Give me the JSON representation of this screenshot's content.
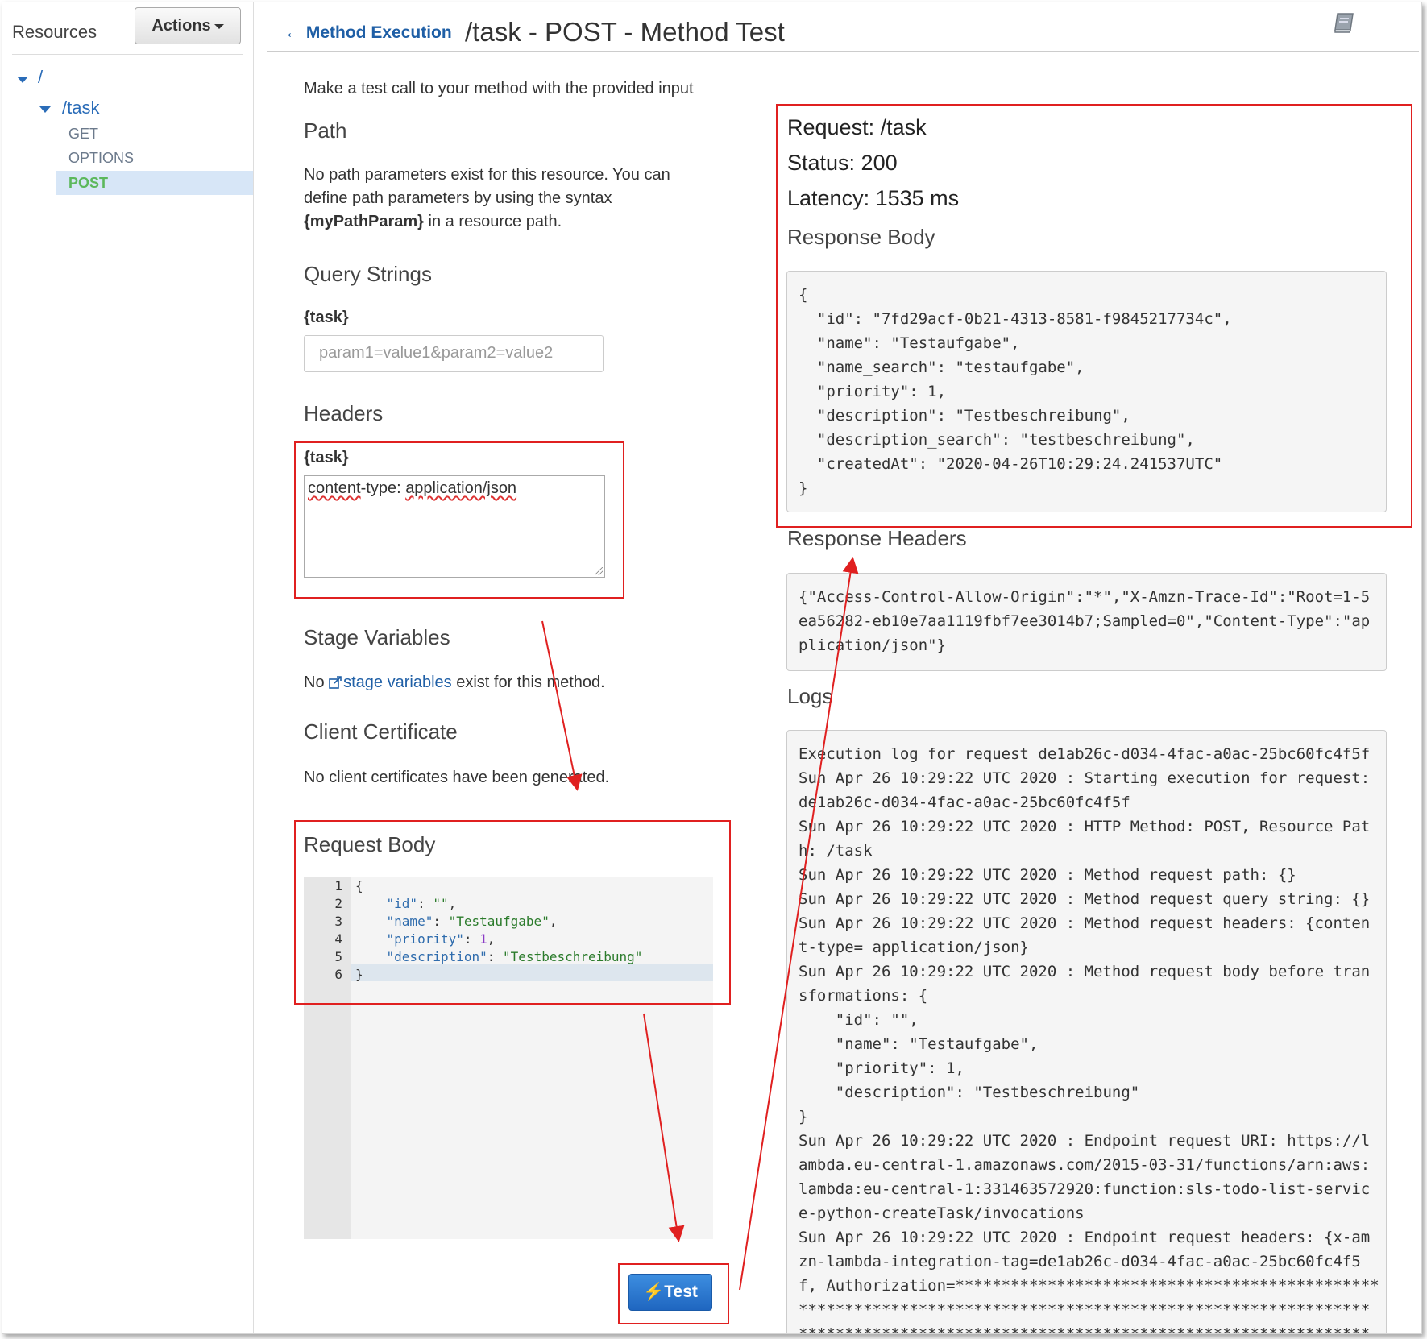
{
  "sidebar": {
    "title": "Resources",
    "actions_label": "Actions",
    "root": "/",
    "resource": "/task",
    "methods": [
      "GET",
      "OPTIONS",
      "POST"
    ]
  },
  "header": {
    "back_label": "Method Execution",
    "title": "/task - POST - Method Test"
  },
  "left": {
    "intro": "Make a test call to your method with the provided input",
    "path_title": "Path",
    "path_text_1": "No path parameters exist for this resource. You can",
    "path_text_2": "define path parameters by using the syntax",
    "path_param": "{myPathParam}",
    "path_text_3": " in a resource path.",
    "query_title": "Query Strings",
    "query_label": "{task}",
    "query_placeholder": "param1=value1&param2=value2",
    "headers_title": "Headers",
    "headers_label": "{task}",
    "headers_value_a": "content",
    "headers_value_b": "-type: ",
    "headers_value_c": "application/json",
    "stage_title": "Stage Variables",
    "stage_pre": "No ",
    "stage_link": "stage variables",
    "stage_post": " exist for this method.",
    "cert_title": "Client Certificate",
    "cert_text": "No client certificates have been generated.",
    "body_title": "Request Body",
    "code_lines": [
      {
        "n": "1",
        "text": "{"
      },
      {
        "n": "2",
        "key": "\"id\"",
        "val": "\"\"",
        "type": "str"
      },
      {
        "n": "3",
        "key": "\"name\"",
        "val": "\"Testaufgabe\"",
        "type": "str"
      },
      {
        "n": "4",
        "key": "\"priority\"",
        "val": "1",
        "type": "num"
      },
      {
        "n": "5",
        "key": "\"description\"",
        "val": "\"Testbeschreibung\"",
        "type": "str",
        "last": true
      },
      {
        "n": "6",
        "text": "}"
      }
    ],
    "test_label": "Test"
  },
  "right": {
    "request": "Request: /task",
    "status": "Status: 200",
    "latency": "Latency: 1535 ms",
    "response_body_title": "Response Body",
    "response_body": "{\n  \"id\": \"7fd29acf-0b21-4313-8581-f9845217734c\",\n  \"name\": \"Testaufgabe\",\n  \"name_search\": \"testaufgabe\",\n  \"priority\": 1,\n  \"description\": \"Testbeschreibung\",\n  \"description_search\": \"testbeschreibung\",\n  \"createdAt\": \"2020-04-26T10:29:24.241537UTC\"\n}",
    "response_headers_title": "Response Headers",
    "response_headers": "{\"Access-Control-Allow-Origin\":\"*\",\"X-Amzn-Trace-Id\":\"Root=1-5\nea56282-eb10e7aa1119fbf7ee3014b7;Sampled=0\",\"Content-Type\":\"ap\nplication/json\"}",
    "logs_title": "Logs",
    "logs": "Execution log for request de1ab26c-d034-4fac-a0ac-25bc60fc4f5f\nSun Apr 26 10:29:22 UTC 2020 : Starting execution for request:\nde1ab26c-d034-4fac-a0ac-25bc60fc4f5f\nSun Apr 26 10:29:22 UTC 2020 : HTTP Method: POST, Resource Pat\nh: /task\nSun Apr 26 10:29:22 UTC 2020 : Method request path: {}\nSun Apr 26 10:29:22 UTC 2020 : Method request query string: {}\nSun Apr 26 10:29:22 UTC 2020 : Method request headers: {conten\nt-type= application/json}\nSun Apr 26 10:29:22 UTC 2020 : Method request body before tran\nsformations: {\n    \"id\": \"\",\n    \"name\": \"Testaufgabe\",\n    \"priority\": 1,\n    \"description\": \"Testbeschreibung\"\n}\nSun Apr 26 10:29:22 UTC 2020 : Endpoint request URI: https://l\nambda.eu-central-1.amazonaws.com/2015-03-31/functions/arn:aws:\nlambda:eu-central-1:331463572920:function:sls-todo-list-servic\ne-python-createTask/invocations\nSun Apr 26 10:29:22 UTC 2020 : Endpoint request headers: {x-am\nzn-lambda-integration-tag=de1ab26c-d034-4fac-a0ac-25bc60fc4f5\nf, Authorization=**********************************************\n**************************************************************\n**************************************************************"
  },
  "colors": {
    "link": "#1f5fa6",
    "annotation": "#e02020",
    "active_method": "#5cb85c",
    "test_button": "#1f66c0"
  }
}
